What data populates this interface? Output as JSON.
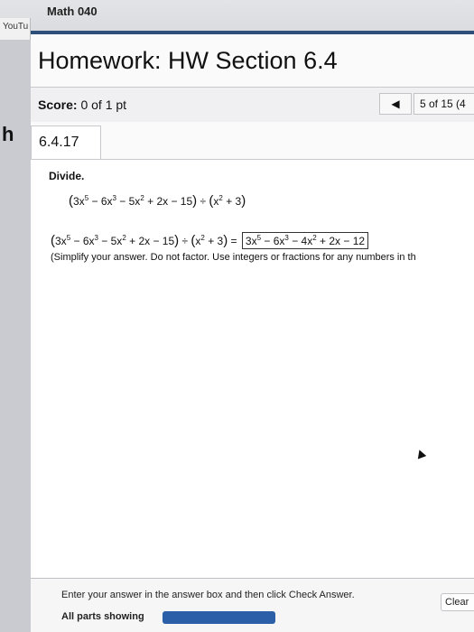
{
  "course": "Math 040",
  "tab": {
    "label": "YouTu"
  },
  "sidebar": {
    "letter": "h"
  },
  "header": {
    "title": "Homework: HW Section 6.4",
    "score_label": "Score:",
    "score_value": "0 of 1 pt",
    "prev_icon": "◀",
    "counter": "5 of 15 (4"
  },
  "question": {
    "id": "6.4.17",
    "prompt": "Divide.",
    "problem": {
      "p1": "3x",
      "e1": "5",
      "p2": " − 6x",
      "e2": "3",
      "p3": " − 5x",
      "e3": "2",
      "p4": " + 2x − 15",
      "divide": " ÷ ",
      "q1": "x",
      "qe1": "2",
      "q2": " + 3"
    },
    "answer": {
      "a1": "3x",
      "ae1": "5",
      "a2": " − 6x",
      "ae2": "3",
      "a3": " − 4x",
      "ae3": "2",
      "a4": " + 2x − 12"
    },
    "equals": " = ",
    "hint": "(Simplify your answer. Do not factor. Use integers or fractions for any numbers in th"
  },
  "footer": {
    "instruction": "Enter your answer in the answer box and then click Check Answer.",
    "all_parts": "All parts showing",
    "progress": 1.0,
    "clear_label": "Clear"
  }
}
